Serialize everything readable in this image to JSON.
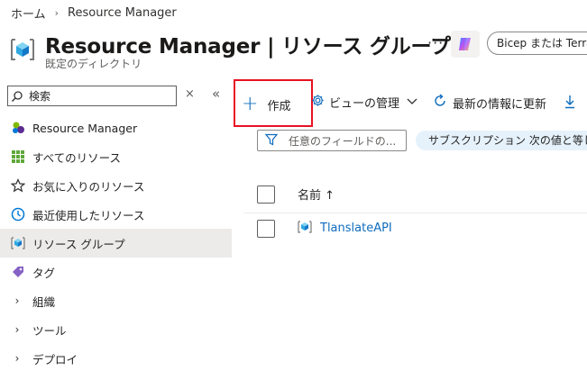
{
  "breadcrumb": {
    "home": "ホーム",
    "current": "Resource Manager"
  },
  "header": {
    "title": "Resource Manager | リソース グループ",
    "subtitle": "既定のディレクトリ",
    "more": "···",
    "bicep_button": "Bicep または Terraform"
  },
  "sidebar": {
    "search_placeholder": "検索",
    "clear": "×",
    "collapse": "«",
    "items": [
      {
        "label": "Resource Manager",
        "icon": "resource-manager-icon"
      },
      {
        "label": "すべてのリソース",
        "icon": "grid-icon"
      },
      {
        "label": "お気に入りのリソース",
        "icon": "star-icon"
      },
      {
        "label": "最近使用したリソース",
        "icon": "clock-icon"
      },
      {
        "label": "リソース グループ",
        "icon": "resource-group-icon",
        "selected": true
      },
      {
        "label": "タグ",
        "icon": "tag-icon"
      },
      {
        "label": "組織",
        "icon": "chevron-right-icon"
      },
      {
        "label": "ツール",
        "icon": "chevron-right-icon"
      },
      {
        "label": "デプロイ",
        "icon": "chevron-right-icon"
      }
    ]
  },
  "toolbar": {
    "create": "作成",
    "manage_view": "ビューの管理",
    "refresh": "最新の情報に更新"
  },
  "filters": {
    "filter_placeholder": "任意のフィールドの...",
    "subscription_pill": "サブスクリプション 次の値と等しい すべて"
  },
  "table": {
    "column_name": "名前 ↑",
    "rows": [
      {
        "name": "TlanslateAPI"
      }
    ]
  },
  "colors": {
    "accent": "#0f6cbd",
    "highlight": "#e81123",
    "selected_bg": "#edebe9",
    "pill_bg": "#e6f2fb"
  }
}
